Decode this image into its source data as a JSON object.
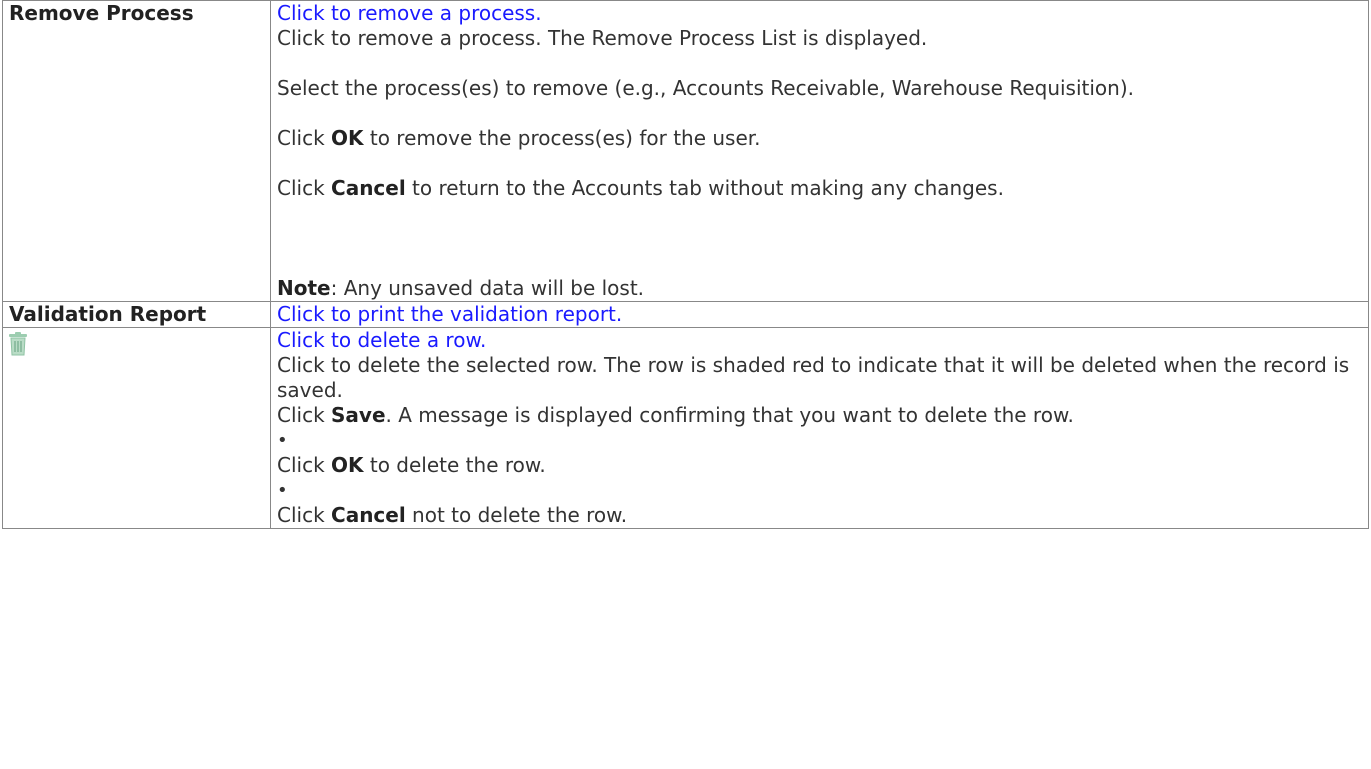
{
  "rows": {
    "remove_process": {
      "term": "Remove Process",
      "link": "Click to remove a process.",
      "line1": "Click to remove a process. The Remove Process List is displayed.",
      "line2": "Select the process(es) to remove (e.g., Accounts Receivable, Warehouse Requisition).",
      "line3_pre": "Click ",
      "line3_bold": "OK",
      "line3_post": " to remove the process(es) for the user.",
      "line4_pre": "Click ",
      "line4_bold": "Cancel",
      "line4_post": " to return to the Accounts tab without making any changes.",
      "note_bold": "Note",
      "note_post": ": Any unsaved data will be lost."
    },
    "validation_report": {
      "term": "Validation Report",
      "link": "Click to print the validation report."
    },
    "delete_row": {
      "icon": "trash-can-icon",
      "link": "Click to delete a row.",
      "line1": "Click to delete the selected row. The row is shaded red to indicate that it will be deleted when the record is saved.",
      "line2_pre": "Click ",
      "line2_bold": "Save",
      "line2_post": ". A message is displayed confirming that you want to delete the row.",
      "bullet": "•",
      "line3_pre": "Click ",
      "line3_bold": "OK",
      "line3_post": " to delete the row.",
      "line4_pre": "Click ",
      "line4_bold": "Cancel",
      "line4_post": " not to delete the row."
    }
  },
  "colors": {
    "link": "#1a1aff",
    "border": "#888888",
    "icon": "#8fc3a4"
  }
}
